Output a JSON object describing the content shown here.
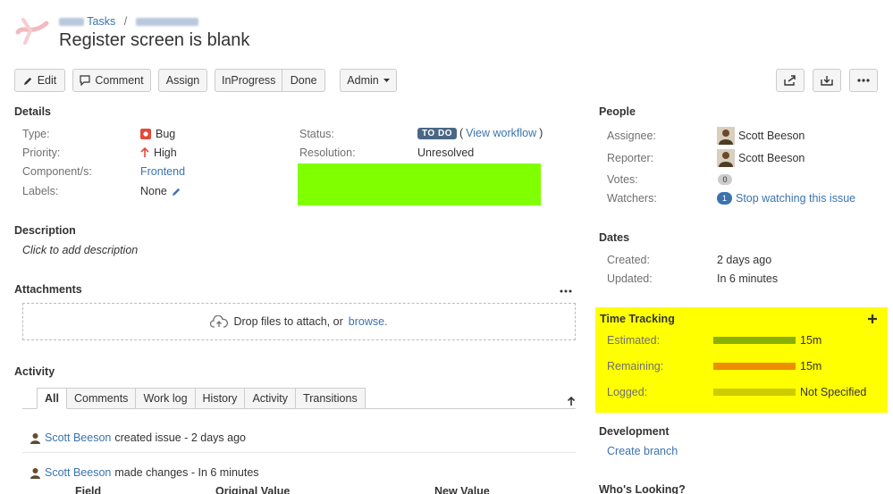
{
  "header": {
    "breadcrumb_project": "Tasks",
    "breadcrumb_sep": "/",
    "title": "Register screen is blank"
  },
  "toolbar": {
    "edit": "Edit",
    "comment": "Comment",
    "assign": "Assign",
    "inprogress": "InProgress",
    "done": "Done",
    "admin": "Admin"
  },
  "details": {
    "heading": "Details",
    "type_label": "Type:",
    "type_value": "Bug",
    "priority_label": "Priority:",
    "priority_value": "High",
    "component_label": "Component/s:",
    "component_value": "Frontend",
    "labels_label": "Labels:",
    "labels_value": "None",
    "status_label": "Status:",
    "status_badge": "TO DO",
    "status_workflow": "View workflow",
    "resolution_label": "Resolution:",
    "resolution_value": "Unresolved",
    "highlight_color": "#80ff00"
  },
  "description": {
    "heading": "Description",
    "placeholder": "Click to add description"
  },
  "attachments": {
    "heading": "Attachments",
    "drop_text": "Drop files to attach, or",
    "browse": "browse."
  },
  "activity": {
    "heading": "Activity",
    "tabs": [
      "All",
      "Comments",
      "Work log",
      "History",
      "Activity",
      "Transitions"
    ],
    "entries": [
      {
        "user": "Scott Beeson",
        "text": "created issue - 2 days ago"
      },
      {
        "user": "Scott Beeson",
        "text": "made changes - In 6 minutes"
      }
    ],
    "columns": [
      "Field",
      "Original Value",
      "New Value"
    ]
  },
  "people": {
    "heading": "People",
    "assignee_label": "Assignee:",
    "assignee": "Scott Beeson",
    "reporter_label": "Reporter:",
    "reporter": "Scott Beeson",
    "votes_label": "Votes:",
    "votes": "0",
    "watchers_label": "Watchers:",
    "watchers_count": "1",
    "watch_link": "Stop watching this issue"
  },
  "dates": {
    "heading": "Dates",
    "created_label": "Created:",
    "created": "2 days ago",
    "updated_label": "Updated:",
    "updated": "In 6 minutes"
  },
  "time_tracking": {
    "heading": "Time Tracking",
    "highlight_color": "#ffff00",
    "estimated_label": "Estimated:",
    "estimated": "15m",
    "estimated_color": "#89b004",
    "remaining_label": "Remaining:",
    "remaining": "15m",
    "remaining_color": "#ec8e00",
    "logged_label": "Logged:",
    "logged": "Not Specified",
    "logged_color": "#cccc00"
  },
  "development": {
    "heading": "Development",
    "create_branch": "Create branch"
  },
  "whos_looking": {
    "heading": "Who's Looking?"
  }
}
